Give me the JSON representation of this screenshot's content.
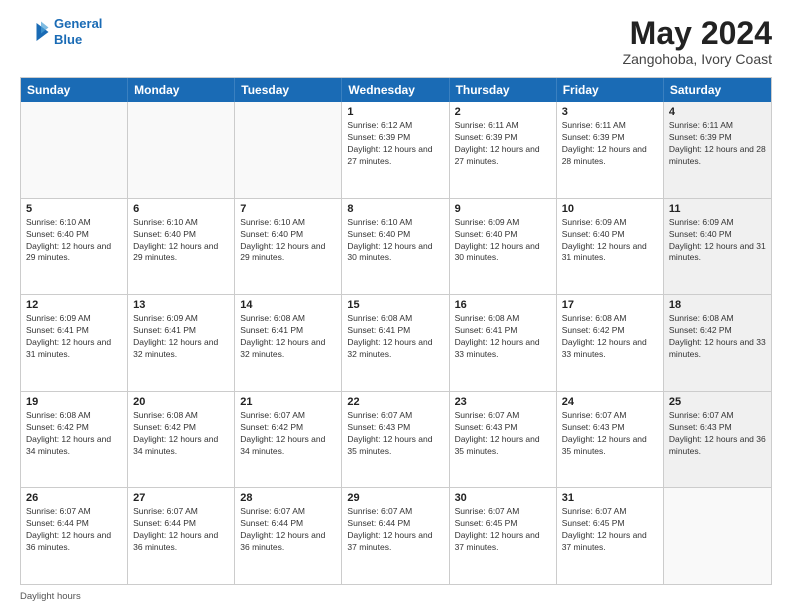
{
  "header": {
    "logo_line1": "General",
    "logo_line2": "Blue",
    "title": "May 2024",
    "subtitle": "Zangohoba, Ivory Coast"
  },
  "days_of_week": [
    "Sunday",
    "Monday",
    "Tuesday",
    "Wednesday",
    "Thursday",
    "Friday",
    "Saturday"
  ],
  "weeks": [
    [
      {
        "day": "",
        "empty": true
      },
      {
        "day": "",
        "empty": true
      },
      {
        "day": "",
        "empty": true
      },
      {
        "day": "1",
        "sunrise": "6:12 AM",
        "sunset": "6:39 PM",
        "daylight": "12 hours and 27 minutes."
      },
      {
        "day": "2",
        "sunrise": "6:11 AM",
        "sunset": "6:39 PM",
        "daylight": "12 hours and 27 minutes."
      },
      {
        "day": "3",
        "sunrise": "6:11 AM",
        "sunset": "6:39 PM",
        "daylight": "12 hours and 28 minutes."
      },
      {
        "day": "4",
        "sunrise": "6:11 AM",
        "sunset": "6:39 PM",
        "daylight": "12 hours and 28 minutes.",
        "shaded": true
      }
    ],
    [
      {
        "day": "5",
        "sunrise": "6:10 AM",
        "sunset": "6:40 PM",
        "daylight": "12 hours and 29 minutes."
      },
      {
        "day": "6",
        "sunrise": "6:10 AM",
        "sunset": "6:40 PM",
        "daylight": "12 hours and 29 minutes."
      },
      {
        "day": "7",
        "sunrise": "6:10 AM",
        "sunset": "6:40 PM",
        "daylight": "12 hours and 29 minutes."
      },
      {
        "day": "8",
        "sunrise": "6:10 AM",
        "sunset": "6:40 PM",
        "daylight": "12 hours and 30 minutes."
      },
      {
        "day": "9",
        "sunrise": "6:09 AM",
        "sunset": "6:40 PM",
        "daylight": "12 hours and 30 minutes."
      },
      {
        "day": "10",
        "sunrise": "6:09 AM",
        "sunset": "6:40 PM",
        "daylight": "12 hours and 31 minutes."
      },
      {
        "day": "11",
        "sunrise": "6:09 AM",
        "sunset": "6:40 PM",
        "daylight": "12 hours and 31 minutes.",
        "shaded": true
      }
    ],
    [
      {
        "day": "12",
        "sunrise": "6:09 AM",
        "sunset": "6:41 PM",
        "daylight": "12 hours and 31 minutes."
      },
      {
        "day": "13",
        "sunrise": "6:09 AM",
        "sunset": "6:41 PM",
        "daylight": "12 hours and 32 minutes."
      },
      {
        "day": "14",
        "sunrise": "6:08 AM",
        "sunset": "6:41 PM",
        "daylight": "12 hours and 32 minutes."
      },
      {
        "day": "15",
        "sunrise": "6:08 AM",
        "sunset": "6:41 PM",
        "daylight": "12 hours and 32 minutes."
      },
      {
        "day": "16",
        "sunrise": "6:08 AM",
        "sunset": "6:41 PM",
        "daylight": "12 hours and 33 minutes."
      },
      {
        "day": "17",
        "sunrise": "6:08 AM",
        "sunset": "6:42 PM",
        "daylight": "12 hours and 33 minutes."
      },
      {
        "day": "18",
        "sunrise": "6:08 AM",
        "sunset": "6:42 PM",
        "daylight": "12 hours and 33 minutes.",
        "shaded": true
      }
    ],
    [
      {
        "day": "19",
        "sunrise": "6:08 AM",
        "sunset": "6:42 PM",
        "daylight": "12 hours and 34 minutes."
      },
      {
        "day": "20",
        "sunrise": "6:08 AM",
        "sunset": "6:42 PM",
        "daylight": "12 hours and 34 minutes."
      },
      {
        "day": "21",
        "sunrise": "6:07 AM",
        "sunset": "6:42 PM",
        "daylight": "12 hours and 34 minutes."
      },
      {
        "day": "22",
        "sunrise": "6:07 AM",
        "sunset": "6:43 PM",
        "daylight": "12 hours and 35 minutes."
      },
      {
        "day": "23",
        "sunrise": "6:07 AM",
        "sunset": "6:43 PM",
        "daylight": "12 hours and 35 minutes."
      },
      {
        "day": "24",
        "sunrise": "6:07 AM",
        "sunset": "6:43 PM",
        "daylight": "12 hours and 35 minutes."
      },
      {
        "day": "25",
        "sunrise": "6:07 AM",
        "sunset": "6:43 PM",
        "daylight": "12 hours and 36 minutes.",
        "shaded": true
      }
    ],
    [
      {
        "day": "26",
        "sunrise": "6:07 AM",
        "sunset": "6:44 PM",
        "daylight": "12 hours and 36 minutes."
      },
      {
        "day": "27",
        "sunrise": "6:07 AM",
        "sunset": "6:44 PM",
        "daylight": "12 hours and 36 minutes."
      },
      {
        "day": "28",
        "sunrise": "6:07 AM",
        "sunset": "6:44 PM",
        "daylight": "12 hours and 36 minutes."
      },
      {
        "day": "29",
        "sunrise": "6:07 AM",
        "sunset": "6:44 PM",
        "daylight": "12 hours and 37 minutes."
      },
      {
        "day": "30",
        "sunrise": "6:07 AM",
        "sunset": "6:45 PM",
        "daylight": "12 hours and 37 minutes."
      },
      {
        "day": "31",
        "sunrise": "6:07 AM",
        "sunset": "6:45 PM",
        "daylight": "12 hours and 37 minutes."
      },
      {
        "day": "",
        "empty": true,
        "shaded": true
      }
    ]
  ],
  "footer": {
    "note": "Daylight hours"
  },
  "colors": {
    "header_bg": "#1a6bb5",
    "header_text": "#ffffff",
    "shaded_bg": "#f0f0f0"
  }
}
